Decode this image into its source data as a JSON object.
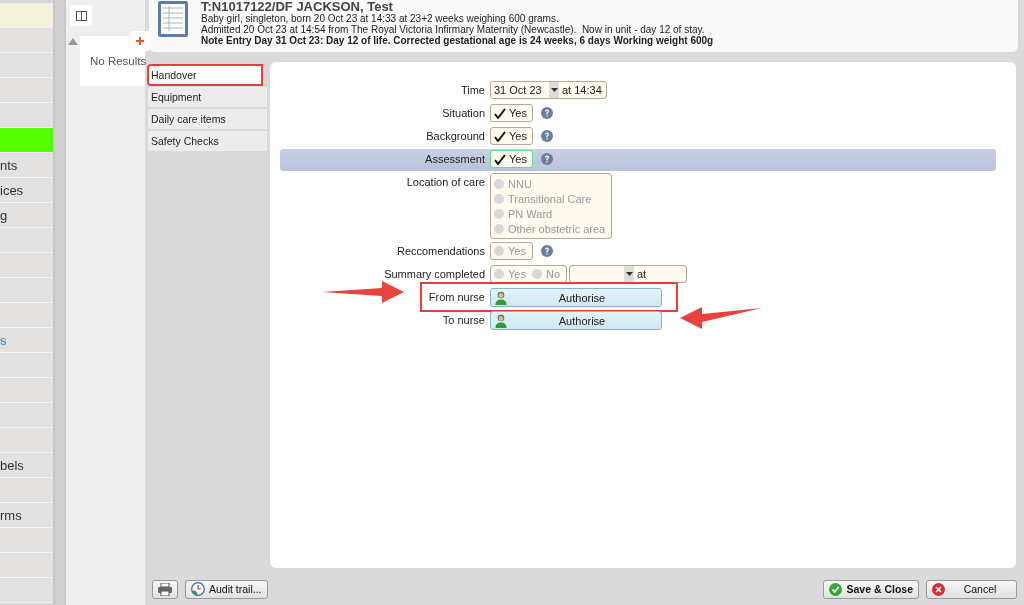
{
  "sidebar": {
    "items": [
      {
        "color": "#f4f2dc",
        "kind": "item"
      },
      {
        "color": "#e4e2e0",
        "kind": "item"
      },
      {
        "color": "#e4e2e0",
        "kind": "item"
      },
      {
        "color": "#e4e2e0",
        "kind": "item"
      },
      {
        "color": "#e4e2e0",
        "kind": "item"
      },
      {
        "color": "#55ff00",
        "kind": "item"
      },
      {
        "color": "#e4e2e0",
        "kind": "item",
        "label": "nts"
      },
      {
        "color": "#e4e2e0",
        "kind": "item",
        "label": "ices"
      },
      {
        "color": "#e4e2e0",
        "kind": "item",
        "label": "g"
      },
      {
        "color": "#e4e2e0",
        "kind": "item"
      },
      {
        "color": "#e4e2e0",
        "kind": "item"
      },
      {
        "color": "#e4e2e0",
        "kind": "item"
      },
      {
        "color": "#e4e2e0",
        "kind": "item"
      },
      {
        "color": "#e4e2e0",
        "kind": "link",
        "label": "s"
      },
      {
        "color": "#e4e2e0",
        "kind": "item"
      },
      {
        "color": "#e4e2e0",
        "kind": "item"
      },
      {
        "color": "#e4e2e0",
        "kind": "item"
      },
      {
        "color": "#e4e2e0",
        "kind": "item"
      },
      {
        "color": "#e4e2e0",
        "kind": "item",
        "label": "bels"
      },
      {
        "color": "#e4e2e0",
        "kind": "item"
      },
      {
        "color": "#e4e2e0",
        "kind": "item",
        "label": "rms"
      },
      {
        "color": "#e4e2e0",
        "kind": "item"
      },
      {
        "color": "#e4e2e0",
        "kind": "item"
      },
      {
        "color": "#e4e2e0",
        "kind": "item"
      }
    ]
  },
  "results": {
    "message": "No Results"
  },
  "dialog": {
    "header": {
      "title": "T:N1017122/DF JACKSON, Test",
      "lines": [
        {
          "kind": "plain",
          "text": "Baby girl, singleton, born 20 Oct 23 at 14:33 at 23+2 weeks weighing 600 grams."
        },
        {
          "kind": "plain",
          "text": "Admitted 20 Oct 23 at 14:54 from The Royal Victoria Infirmary Maternity (Newcastle).  Now in unit - day 12 of stay."
        },
        {
          "kind": "bold",
          "text": "Note Entry Day 31 Oct 23: Day 12 of life. Corrected gestational age is 24 weeks, 6 days Working weight 600g"
        }
      ]
    },
    "tabs": [
      {
        "label": "Handover",
        "selected": true,
        "boxed": true
      },
      {
        "label": "Equipment",
        "selected": false,
        "boxed": false
      },
      {
        "label": "Daily care items",
        "selected": false,
        "boxed": false
      },
      {
        "label": "Safety Checks",
        "selected": false,
        "boxed": false
      }
    ],
    "fields": [
      {
        "kind": "datetime",
        "label": "Time",
        "value": "31 Oct 23",
        "time_text": "at 14:34",
        "highlighted": false,
        "help": false
      },
      {
        "kind": "checkbox",
        "label": "Situation",
        "option": "Yes",
        "checked": true,
        "focused": false,
        "highlighted": false,
        "help": true
      },
      {
        "kind": "checkbox",
        "label": "Background",
        "option": "Yes",
        "checked": true,
        "focused": false,
        "highlighted": false,
        "help": true
      },
      {
        "kind": "checkbox",
        "label": "Assessment",
        "option": "Yes",
        "checked": true,
        "focused": true,
        "highlighted": true,
        "help": true
      },
      {
        "kind": "radio_list",
        "label": "Location of care",
        "disabled": true,
        "highlighted": false,
        "help": false,
        "options": [
          {
            "label": "NNU",
            "selected": false
          },
          {
            "label": "Transitional Care",
            "selected": false
          },
          {
            "label": "PN Ward",
            "selected": false
          },
          {
            "label": "Other obstetric area",
            "selected": false
          }
        ]
      },
      {
        "kind": "radio_inline",
        "label": "Reccomendations",
        "disabled": true,
        "highlighted": false,
        "help": true,
        "options": [
          {
            "label": "Yes",
            "selected": false
          }
        ]
      },
      {
        "kind": "radio_datetime",
        "label": "Summary completed",
        "disabled": true,
        "highlighted": false,
        "help": false,
        "time_text": "at",
        "options": [
          {
            "label": "Yes",
            "selected": false
          },
          {
            "label": "No",
            "selected": false
          }
        ]
      },
      {
        "kind": "authorise",
        "label": "From nurse",
        "button": "Authorise",
        "highlighted": false,
        "help": false,
        "boxed": true,
        "arrow_left": true,
        "arrow_right": false
      },
      {
        "kind": "authorise",
        "label": "To nurse",
        "button": "Authorise",
        "highlighted": false,
        "help": false,
        "boxed": false,
        "arrow_left": false,
        "arrow_right": true
      }
    ],
    "footer": {
      "left": [
        {
          "kind": "print"
        },
        {
          "kind": "audit",
          "label": "Audit trail..."
        }
      ],
      "right": [
        {
          "kind": "save",
          "label": "Save & Close"
        },
        {
          "kind": "cancel",
          "label": "Cancel"
        }
      ]
    }
  }
}
